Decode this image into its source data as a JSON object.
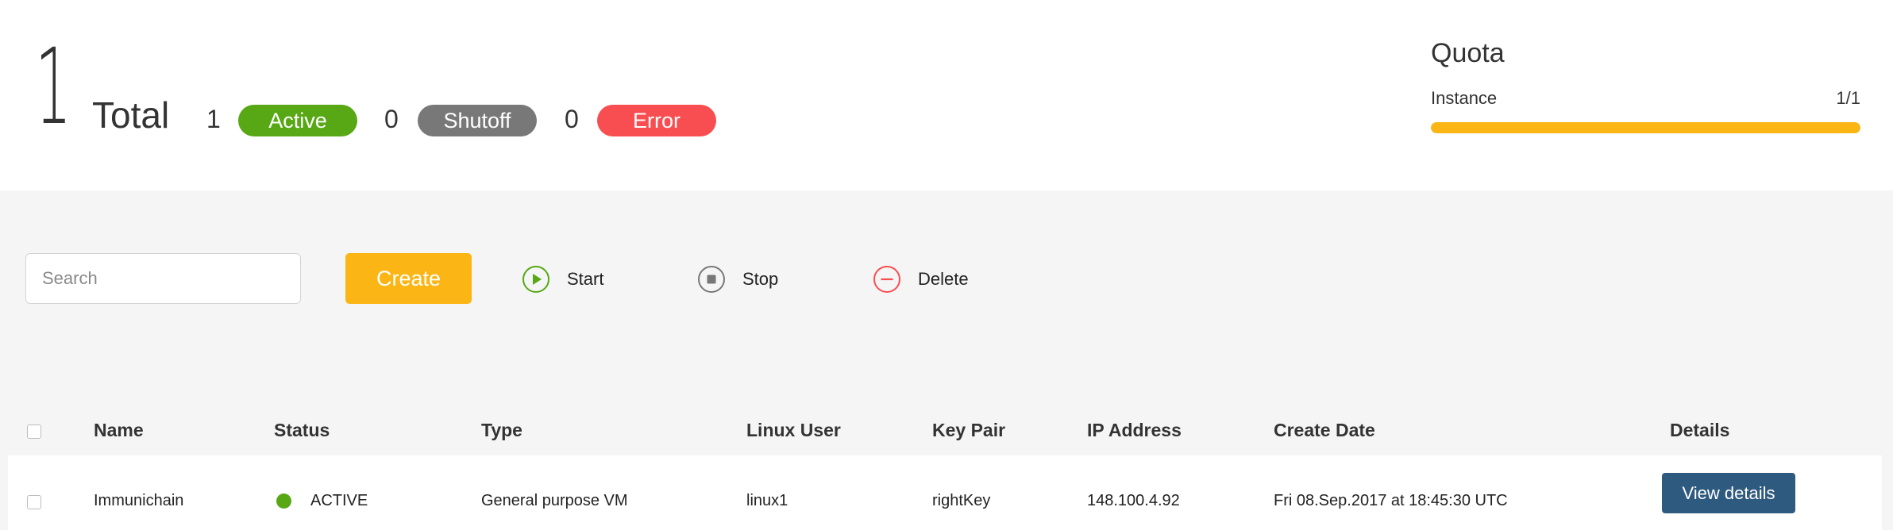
{
  "summary": {
    "total_count": "1",
    "total_label": "Total",
    "stats": [
      {
        "count": "1",
        "label": "Active",
        "color": "#57a814"
      },
      {
        "count": "0",
        "label": "Shutoff",
        "color": "#787878"
      },
      {
        "count": "0",
        "label": "Error",
        "color": "#f84e51"
      }
    ]
  },
  "quota": {
    "title": "Quota",
    "label": "Instance",
    "value": "1/1",
    "fraction": 1.0,
    "bar_color": "#fbb616"
  },
  "toolbar": {
    "search_placeholder": "Search",
    "create_label": "Create",
    "actions": [
      {
        "label": "Start",
        "icon": "play-circle-icon",
        "color": "#57a814"
      },
      {
        "label": "Stop",
        "icon": "stop-circle-icon",
        "color": "#787878"
      },
      {
        "label": "Delete",
        "icon": "minus-circle-icon",
        "color": "#f84e51"
      }
    ]
  },
  "table": {
    "headers": [
      "Name",
      "Status",
      "Type",
      "Linux User",
      "Key Pair",
      "IP Address",
      "Create Date",
      "Details"
    ],
    "rows": [
      {
        "name": "Immunichain",
        "status": "ACTIVE",
        "type": "General purpose VM",
        "linux_user": "linux1",
        "key_pair": "rightKey",
        "ip_address": "148.100.4.92",
        "create_date": "Fri 08.Sep.2017 at 18:45:30 UTC",
        "details_label": "View details"
      }
    ]
  }
}
